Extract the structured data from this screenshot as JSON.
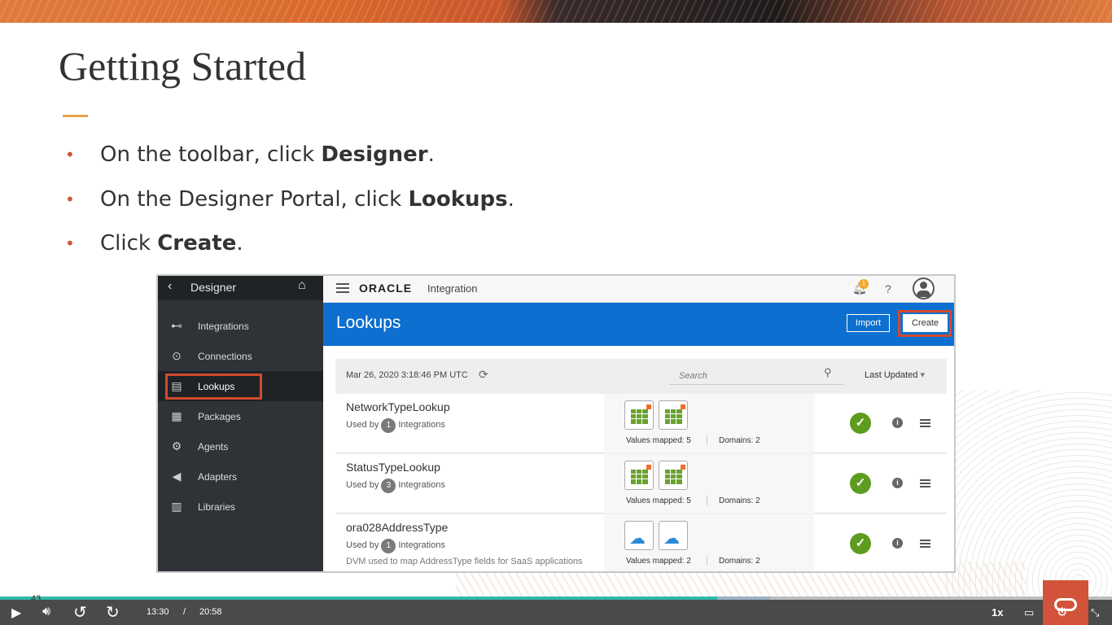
{
  "slide": {
    "title": "Getting Started",
    "bullets": [
      {
        "pre": "On the toolbar, click ",
        "bold": "Designer",
        "post": "."
      },
      {
        "pre": "On the Designer Portal, click ",
        "bold": "Lookups",
        "post": "."
      },
      {
        "pre": "Click ",
        "bold": "Create",
        "post": "."
      }
    ]
  },
  "sidebar": {
    "header": "Designer",
    "items": [
      {
        "label": "Integrations",
        "icon": "integrations-icon"
      },
      {
        "label": "Connections",
        "icon": "connections-icon"
      },
      {
        "label": "Lookups",
        "icon": "lookups-icon",
        "active": true
      },
      {
        "label": "Packages",
        "icon": "packages-icon"
      },
      {
        "label": "Agents",
        "icon": "gear-icon"
      },
      {
        "label": "Adapters",
        "icon": "plug-icon"
      },
      {
        "label": "Libraries",
        "icon": "books-icon"
      }
    ]
  },
  "topbar": {
    "brand": "ORACLE",
    "product": "Integration",
    "notification_count": "1",
    "help": "?"
  },
  "page": {
    "title": "Lookups",
    "import_label": "Import",
    "create_label": "Create"
  },
  "filter": {
    "timestamp": "Mar 26, 2020 3:18:46 PM UTC",
    "search_placeholder": "Search",
    "sort_label": "Last Updated"
  },
  "lookups": [
    {
      "name": "NetworkTypeLookup",
      "used_prefix": "Used by",
      "used_count": "1",
      "used_suffix": "Integrations",
      "description": "",
      "values_mapped": "Values mapped: 5",
      "domains": "Domains: 2",
      "tile_icon": "grid-icon"
    },
    {
      "name": "StatusTypeLookup",
      "used_prefix": "Used by",
      "used_count": "3",
      "used_suffix": "Integrations",
      "description": "",
      "values_mapped": "Values mapped: 5",
      "domains": "Domains: 2",
      "tile_icon": "grid-icon"
    },
    {
      "name": "ora028AddressType",
      "used_prefix": "Used by",
      "used_count": "1",
      "used_suffix": "Integrations",
      "description": "DVM used to map AddressType fields for SaaS applications",
      "values_mapped": "Values mapped: 2",
      "domains": "Domains: 2",
      "tile_icon": "cloud-icon"
    }
  ],
  "player": {
    "slide_number": "43",
    "current_time": "13:30",
    "separator": "/",
    "duration": "20:58",
    "speed": "1x",
    "progress": 0.645
  },
  "colors": {
    "accent_red": "#d34a2e",
    "oracle_blue": "#0d6fcf",
    "sidebar_bg": "#2f3337",
    "status_green": "#5d9c1e"
  }
}
